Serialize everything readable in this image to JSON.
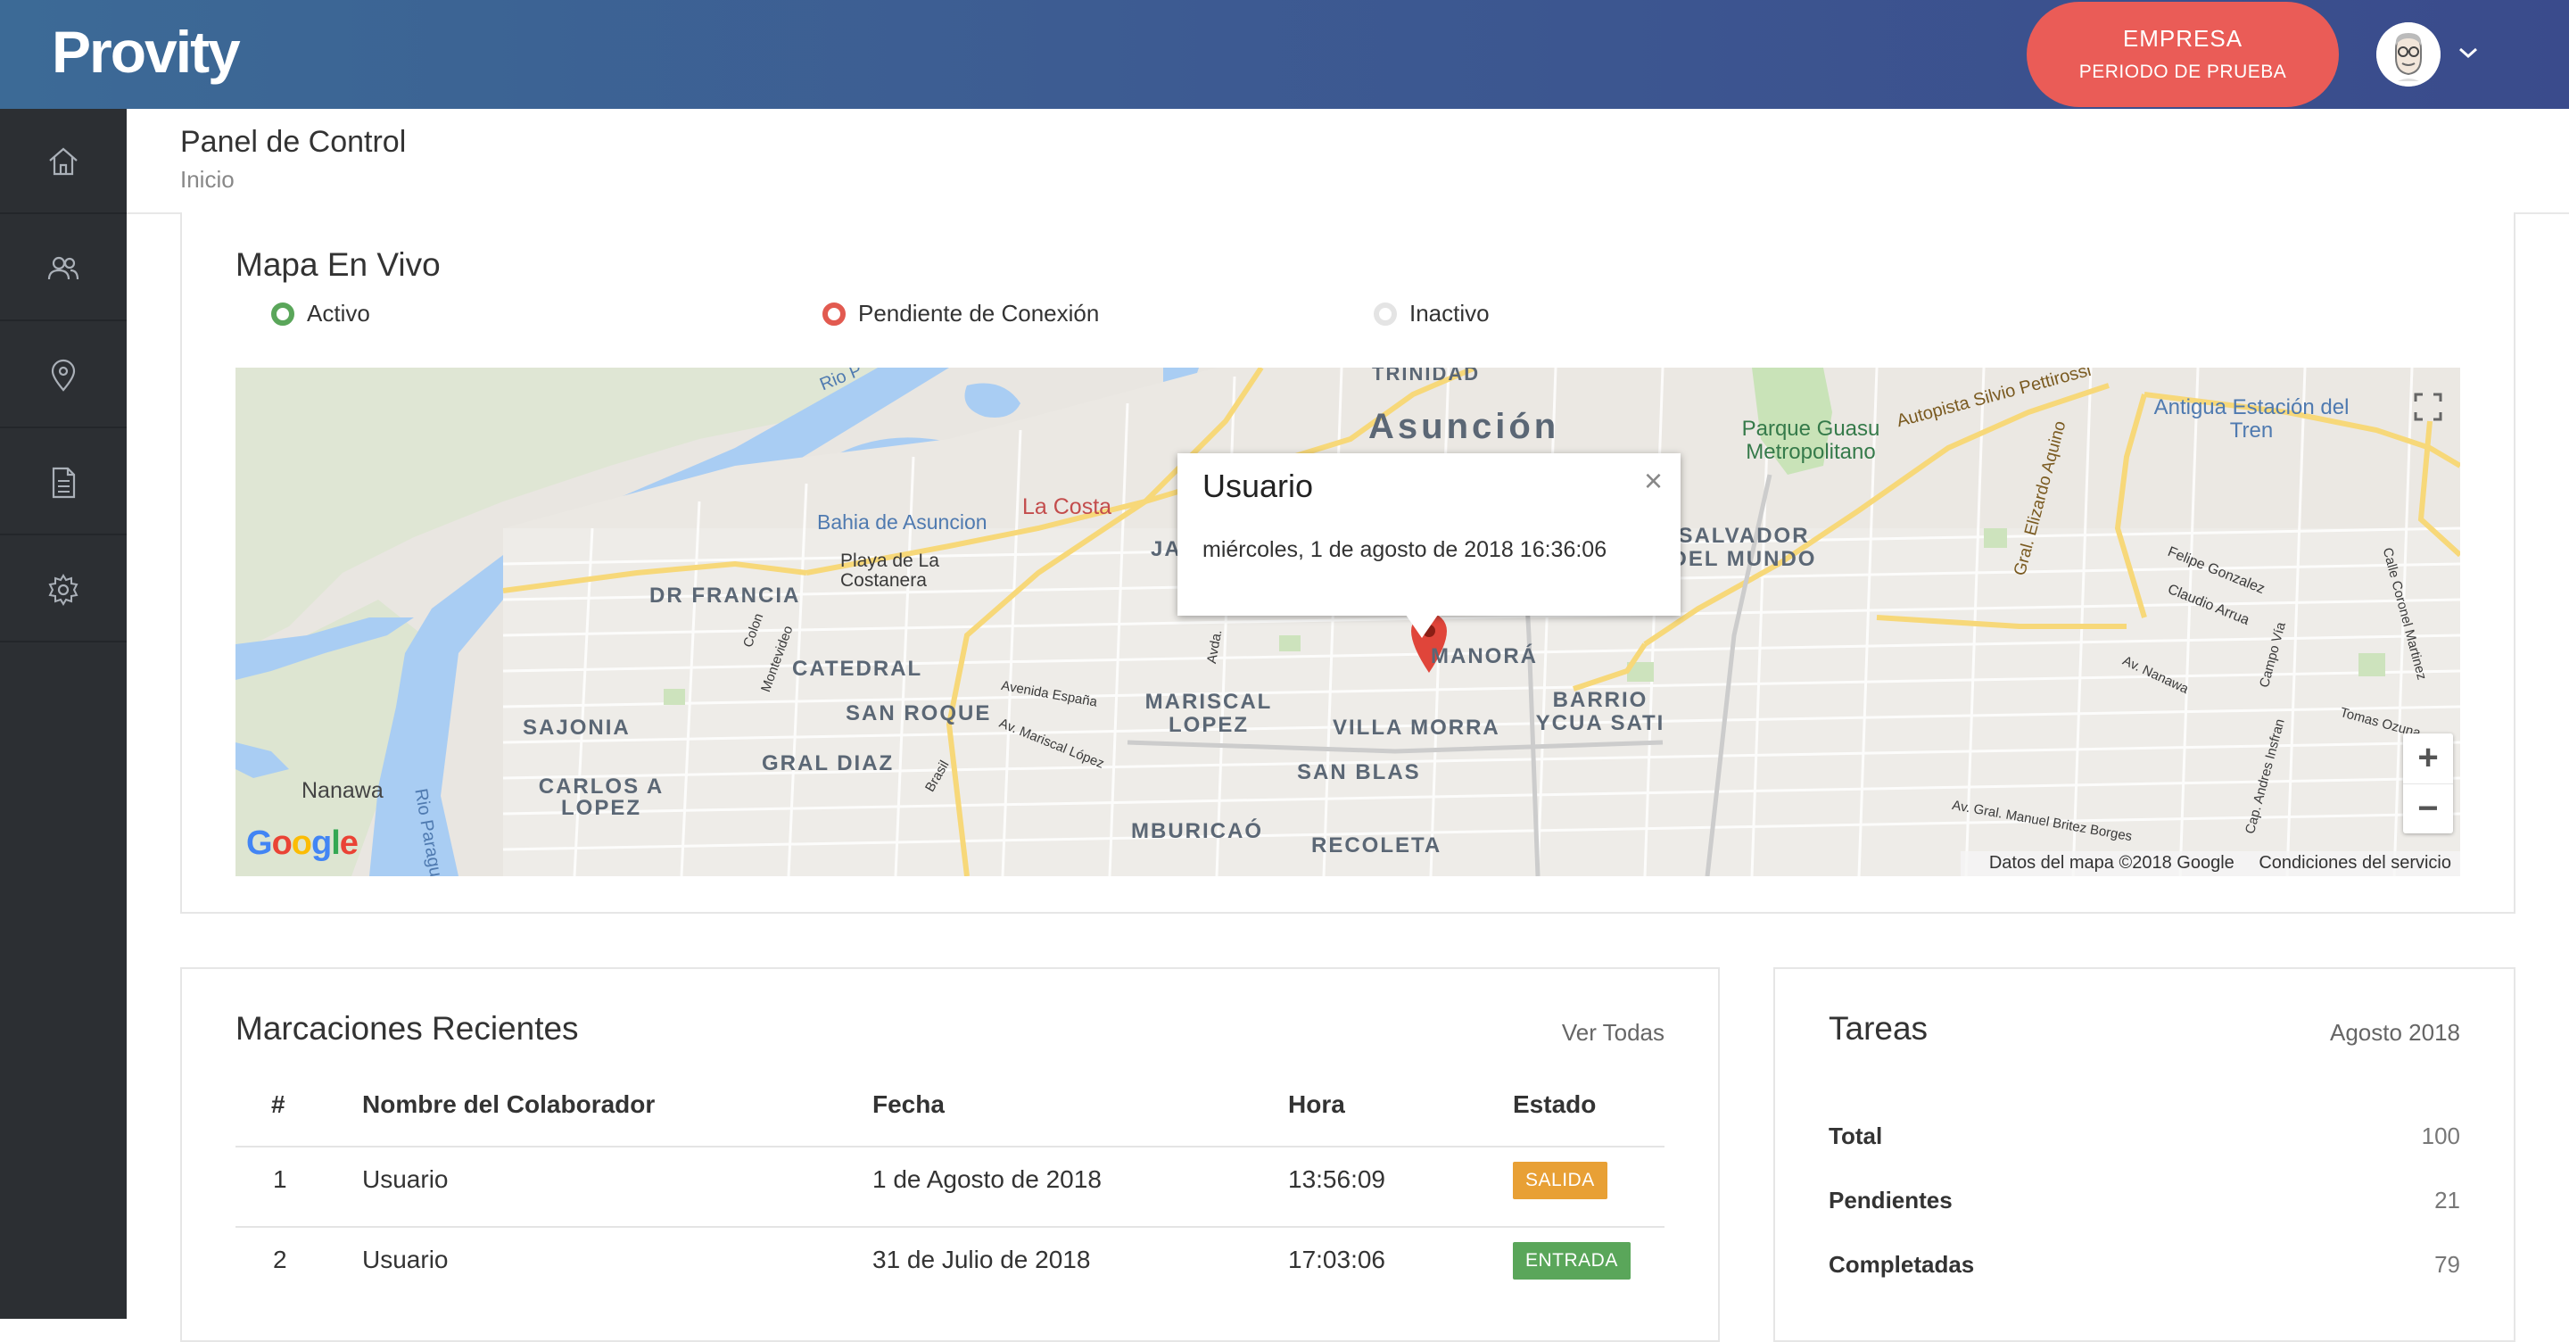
{
  "app": {
    "logo": "Provity"
  },
  "header": {
    "empresa_label": "EMPRESA",
    "plan_label": "PERIODO DE PRUEBA"
  },
  "sidebar": {
    "items": [
      {
        "icon": "home-icon"
      },
      {
        "icon": "users-icon"
      },
      {
        "icon": "location-pin-icon"
      },
      {
        "icon": "document-icon"
      },
      {
        "icon": "gear-icon"
      }
    ]
  },
  "page": {
    "title": "Panel de Control",
    "breadcrumb": "Inicio"
  },
  "map_section": {
    "title": "Mapa En Vivo",
    "legend": [
      {
        "label": "Activo",
        "color": "#5aa65a"
      },
      {
        "label": "Pendiente de Conexión",
        "color": "#e25a50"
      },
      {
        "label": "Inactivo",
        "color": "#dddddd"
      }
    ],
    "popup": {
      "title": "Usuario",
      "text": "miércoles, 1 de agosto de 2018 16:36:06",
      "close": "×"
    },
    "labels": {
      "asuncion": "Asunción",
      "trinidad": "TRINIDAD",
      "bahia": "Bahia de Asuncion",
      "la_costa": "La Costa",
      "playa": "Playa de La Costanera",
      "dr_francia": "DR FRANCIA",
      "catedral": "CATEDRAL",
      "san_roque": "SAN ROQUE",
      "sajonia": "SAJONIA",
      "gral_diaz": "GRAL DIAZ",
      "carlos_lopez": "CARLOS A LOPEZ",
      "nanawa": "Nanawa",
      "mariscal_lopez": "MARISCAL LOPEZ",
      "villa_morra": "VILLA MORRA",
      "manora": "MANORÁ",
      "san_blas": "SAN BLAS",
      "mburicao": "MBURICAÓ",
      "recoleta": "RECOLETA",
      "barrio_ycua": "BARRIO YCUA SATI",
      "salvador": "SALVADOR DEL MUNDO",
      "parque": "Parque Guasu Metropolitano",
      "antigua": "Antigua Estación del Tren",
      "autopista": "Autopista Silvio Pettirossi",
      "gral_elizardo": "Gral. Elizardo Aquino",
      "rio": "Rio P",
      "rio_paraguay": "Rio Paragu",
      "avenida_espana": "Avenida España",
      "av_mariscal": "Av. Mariscal López",
      "colon": "Colon",
      "montevideo": "Montevideo",
      "brasil": "Brasil",
      "avda": "Avda.",
      "ja": "JA",
      "felipe": "Felipe Gonzalez",
      "claudio": "Claudio Arrua",
      "campo_via": "Campo Vía",
      "av_nanawa": "Av. Nanawa",
      "tomas": "Tomas Ozuna",
      "calle_coronel": "Calle Coronel Martinez",
      "cap_insfran": "Cap. Andres Insfran",
      "av_gral": "Av. Gral. Manuel Britez Borges"
    },
    "footer": {
      "data": "Datos del mapa ©2018 Google",
      "terms": "Condiciones del servicio"
    },
    "zoom_in": "+",
    "zoom_out": "−",
    "google": "Google"
  },
  "marcaciones": {
    "title": "Marcaciones Recientes",
    "ver_todas": "Ver Todas",
    "columns": [
      "#",
      "Nombre del Colaborador",
      "Fecha",
      "Hora",
      "Estado"
    ],
    "rows": [
      {
        "num": "1",
        "name": "Usuario",
        "date": "1 de Agosto de 2018",
        "time": "13:56:09",
        "status": "SALIDA",
        "status_color": "#e8a035"
      },
      {
        "num": "2",
        "name": "Usuario",
        "date": "31 de Julio de 2018",
        "time": "17:03:06",
        "status": "ENTRADA",
        "status_color": "#5aa65a"
      }
    ]
  },
  "tareas": {
    "title": "Tareas",
    "period": "Agosto 2018",
    "stats": [
      {
        "label": "Total",
        "value": "100"
      },
      {
        "label": "Pendientes",
        "value": "21"
      },
      {
        "label": "Completadas",
        "value": "79"
      }
    ]
  }
}
